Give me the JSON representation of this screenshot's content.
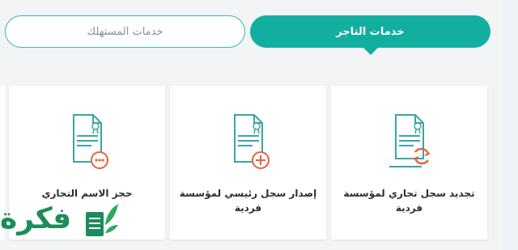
{
  "tabs": {
    "merchant": "خدمات التاجر",
    "consumer": "خدمات المستهلك"
  },
  "cards": [
    {
      "label": "تجديد سجل تجاري لمؤسسة فردية",
      "icon": "document-renew-icon"
    },
    {
      "label": "إصدار سجل رئيسي لمؤسسة فردية",
      "icon": "document-add-icon"
    },
    {
      "label": "حجز الاسم التجاري",
      "icon": "document-more-icon"
    }
  ],
  "watermark": {
    "text": "فكرة"
  },
  "colors": {
    "accent": "#12aea0",
    "icon_teal": "#3aa6a3",
    "icon_orange": "#e8623a",
    "logo_green": "#1d8c5b"
  }
}
